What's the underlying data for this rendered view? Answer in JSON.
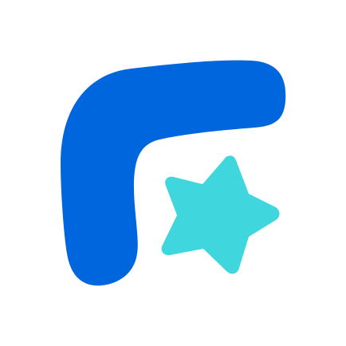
{
  "logo": {
    "icons": [
      "rounded-f-shape-icon",
      "star-icon"
    ],
    "colors": {
      "background": "#ffffff",
      "f_shape": "#0066DD",
      "star": "#40D6DD"
    }
  }
}
